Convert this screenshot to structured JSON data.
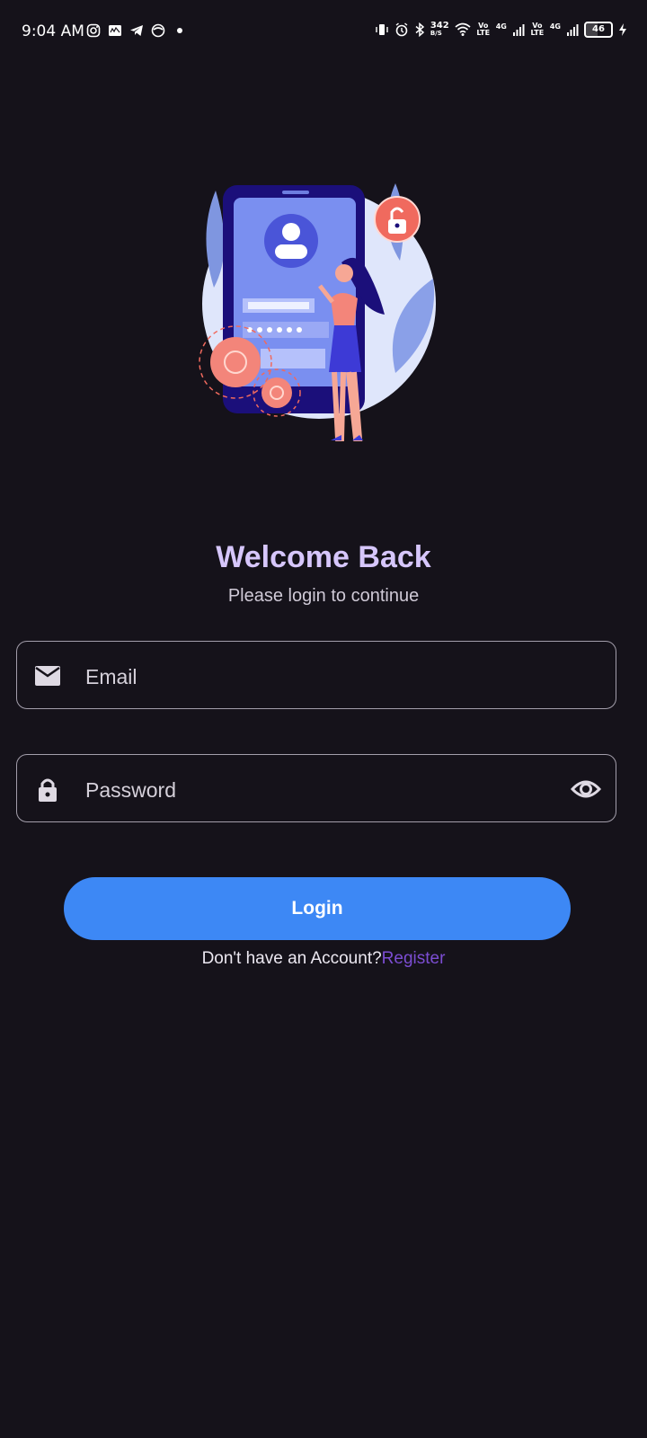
{
  "status_bar": {
    "time": "9:04 AM",
    "network_speed": "342",
    "network_speed_unit": "B/S",
    "volte1": "Vo LTE",
    "net1": "4G",
    "volte2": "Vo LTE",
    "net2": "4G",
    "battery": "46"
  },
  "welcome": {
    "title": "Welcome Back",
    "subtitle": "Please login to continue"
  },
  "form": {
    "email_placeholder": "Email",
    "password_placeholder": "Password",
    "login_label": "Login"
  },
  "footer": {
    "prompt": "Don't have an Account?",
    "register_label": "Register"
  },
  "colors": {
    "background": "#15121a",
    "title": "#d6c6fb",
    "accent_button": "#3d88f5",
    "register_link": "#7c4dd3"
  }
}
